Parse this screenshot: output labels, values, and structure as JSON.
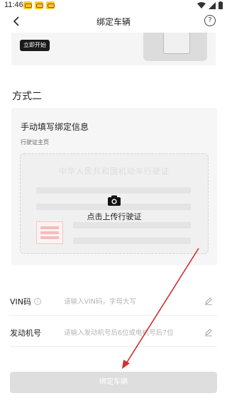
{
  "status_bar": {
    "time": "11:46"
  },
  "header": {
    "title": "绑定车辆",
    "back_icon": "back-arrow-icon",
    "help_icon": "help-circle-icon",
    "help_glyph": "?"
  },
  "top_card": {
    "start_button_label": "立即开始"
  },
  "section": {
    "title": "方式二"
  },
  "form_card": {
    "title": "手动填写绑定信息",
    "subtitle": "行驶证主页",
    "license_watermark": "中华人民共和国机动车行驶证",
    "upload_label": "点击上传行驶证",
    "upload_icon": "camera-icon"
  },
  "fields": {
    "vin": {
      "label": "VIN码",
      "placeholder": "请输入VIN码，字母大写",
      "value": ""
    },
    "engine": {
      "label": "发动机号",
      "placeholder": "请输入发动机号后6位或电机号后7位",
      "value": ""
    }
  },
  "info_glyph": "i",
  "submit": {
    "label": "绑定车辆"
  },
  "colors": {
    "annotation_arrow": "#d32f2f",
    "primary_dark": "#1a1a1a",
    "disabled_button": "#dedede"
  }
}
